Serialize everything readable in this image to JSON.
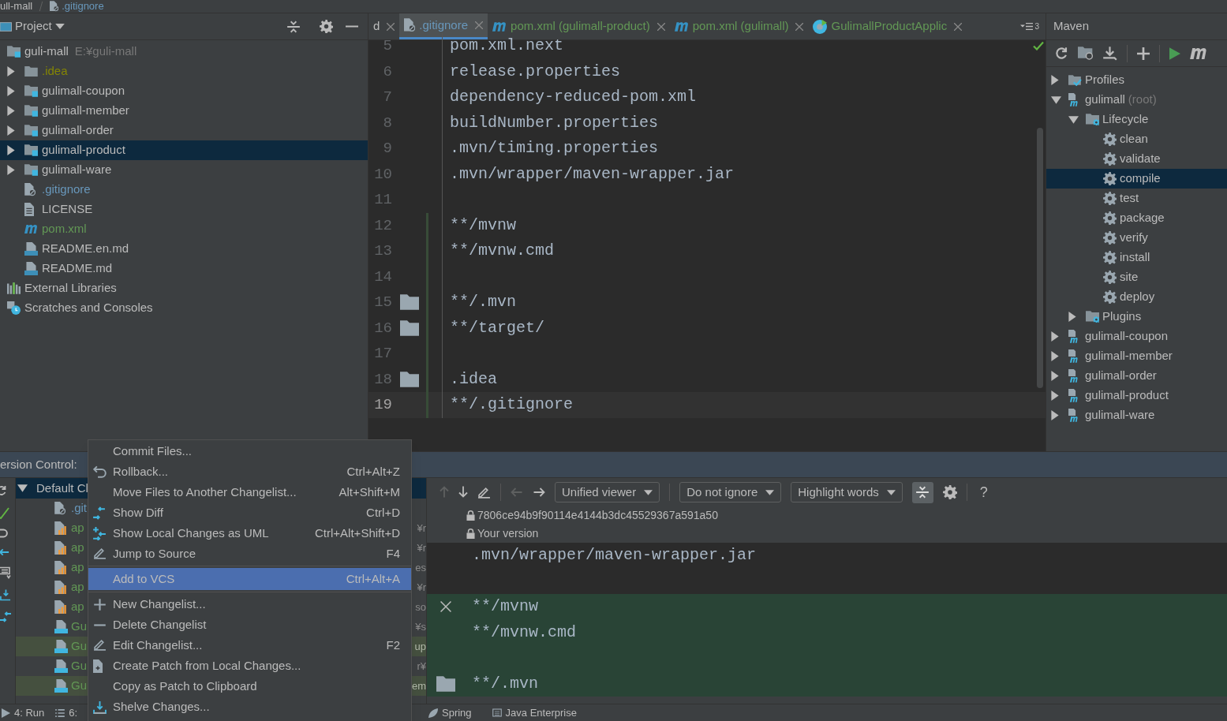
{
  "breadcrumb": [
    {
      "text": "ull-mall",
      "kind": "plain"
    },
    {
      "text": ".gitignore",
      "kind": "gitignore"
    }
  ],
  "project_panel": {
    "title": "Project",
    "tree": [
      {
        "label": "guli-mall",
        "detail": "E:¥guli-mall",
        "kind": "module",
        "selected": false,
        "children": [
          {
            "label": ".idea",
            "kind": "ignored_folder",
            "expanded": false,
            "selected": false
          },
          {
            "label": "gulimall-coupon",
            "kind": "module",
            "expanded": false,
            "selected": false
          },
          {
            "label": "gulimall-member",
            "kind": "module",
            "expanded": false,
            "selected": false
          },
          {
            "label": "gulimall-order",
            "kind": "module",
            "expanded": false,
            "selected": false
          },
          {
            "label": "gulimall-product",
            "kind": "module",
            "expanded": false,
            "selected": true
          },
          {
            "label": "gulimall-ware",
            "kind": "module",
            "expanded": false,
            "selected": false
          },
          {
            "label": ".gitignore",
            "kind": "gitignore",
            "selected": false
          },
          {
            "label": "LICENSE",
            "kind": "text",
            "selected": false
          },
          {
            "label": "pom.xml",
            "kind": "pom",
            "selected": false
          },
          {
            "label": "README.en.md",
            "kind": "md",
            "selected": false
          },
          {
            "label": "README.md",
            "kind": "md",
            "selected": false
          }
        ]
      },
      {
        "label": "External Libraries",
        "kind": "libraries",
        "selected": false
      },
      {
        "label": "Scratches and Consoles",
        "kind": "scratches",
        "selected": false
      }
    ]
  },
  "tabs": [
    {
      "label": "d",
      "kind": "plain",
      "selected": false
    },
    {
      "label": ".gitignore",
      "kind": "gitignore",
      "selected": true
    },
    {
      "label": "pom.xml (gulimall-product)",
      "kind": "pom",
      "selected": false
    },
    {
      "label": "pom.xml (gulimall)",
      "kind": "pom",
      "selected": false
    },
    {
      "label": "GulimallProductApplic",
      "kind": "app",
      "selected": false
    }
  ],
  "tab_overflow_count": "3",
  "editor_lines": [
    {
      "number": "5",
      "text": "pom.xml.next",
      "folder_icon": false,
      "changed": false,
      "current": false
    },
    {
      "number": "6",
      "text": "release.properties",
      "folder_icon": false,
      "changed": false,
      "current": false
    },
    {
      "number": "7",
      "text": "dependency-reduced-pom.xml",
      "folder_icon": false,
      "changed": false,
      "current": false
    },
    {
      "number": "8",
      "text": "buildNumber.properties",
      "folder_icon": false,
      "changed": false,
      "current": false
    },
    {
      "number": "9",
      "text": ".mvn/timing.properties",
      "folder_icon": false,
      "changed": false,
      "current": false
    },
    {
      "number": "10",
      "text": ".mvn/wrapper/maven-wrapper.jar",
      "folder_icon": false,
      "changed": false,
      "current": false
    },
    {
      "number": "11",
      "folder_icon": false,
      "changed": false,
      "current": false
    },
    {
      "number": "12",
      "text": "**/mvnw",
      "folder_icon": false,
      "changed": true,
      "current": false
    },
    {
      "number": "13",
      "text": "**/mvnw.cmd",
      "folder_icon": false,
      "changed": true,
      "current": false
    },
    {
      "number": "14",
      "folder_icon": false,
      "changed": true,
      "current": false
    },
    {
      "number": "15",
      "text": "**/.mvn",
      "folder_icon": true,
      "changed": true,
      "current": false
    },
    {
      "number": "16",
      "text": "**/target/",
      "folder_icon": true,
      "changed": true,
      "current": false
    },
    {
      "number": "17",
      "folder_icon": false,
      "changed": true,
      "current": false
    },
    {
      "number": "18",
      "text": ".idea",
      "folder_icon": true,
      "changed": true,
      "current": false
    },
    {
      "number": "19",
      "text": "**/.gitignore",
      "folder_icon": false,
      "changed": true,
      "current": true
    }
  ],
  "maven_panel": {
    "title": "Maven",
    "tree": [
      {
        "label": "Profiles",
        "kind": "profiles",
        "expanded": false,
        "selected": false
      },
      {
        "label": "gulimall",
        "detail": "(root)",
        "kind": "mvnmodule",
        "expanded": true,
        "selected": false,
        "children": [
          {
            "label": "Lifecycle",
            "kind": "lifecycle",
            "expanded": true,
            "selected": false,
            "children": [
              {
                "label": "clean",
                "kind": "goal",
                "selected": false
              },
              {
                "label": "validate",
                "kind": "goal",
                "selected": false
              },
              {
                "label": "compile",
                "kind": "goal",
                "selected": true
              },
              {
                "label": "test",
                "kind": "goal",
                "selected": false
              },
              {
                "label": "package",
                "kind": "goal",
                "selected": false
              },
              {
                "label": "verify",
                "kind": "goal",
                "selected": false
              },
              {
                "label": "install",
                "kind": "goal",
                "selected": false
              },
              {
                "label": "site",
                "kind": "goal",
                "selected": false
              },
              {
                "label": "deploy",
                "kind": "goal",
                "selected": false
              }
            ]
          },
          {
            "label": "Plugins",
            "kind": "lifecycle",
            "expanded": false,
            "selected": false
          }
        ]
      },
      {
        "label": "gulimall-coupon",
        "kind": "mvnmodule",
        "expanded": false,
        "selected": false
      },
      {
        "label": "gulimall-member",
        "kind": "mvnmodule",
        "expanded": false,
        "selected": false
      },
      {
        "label": "gulimall-order",
        "kind": "mvnmodule",
        "expanded": false,
        "selected": false
      },
      {
        "label": "gulimall-product",
        "kind": "mvnmodule",
        "expanded": false,
        "selected": false
      },
      {
        "label": "gulimall-ware",
        "kind": "mvnmodule",
        "expanded": false,
        "selected": false
      }
    ]
  },
  "version_control": {
    "title": "ersion Control:",
    "changelist": {
      "label": "Default Cl",
      "expanded": true,
      "selected": true,
      "children": [
        {
          "label": ".git",
          "kind": "gitignore",
          "selected": false
        },
        {
          "label": "ap",
          "kind": "chart",
          "path": "¥r",
          "selected": false
        },
        {
          "label": "ap",
          "kind": "chart",
          "path": "¥r",
          "selected": false
        },
        {
          "label": "ap",
          "kind": "chart",
          "path": "es",
          "selected": false
        },
        {
          "label": "ap",
          "kind": "chart",
          "path": "¥r",
          "selected": false
        },
        {
          "label": "ap",
          "kind": "chart",
          "path": "so",
          "selected": false
        },
        {
          "label": "Gu",
          "kind": "java",
          "path": "¥s",
          "selected": false
        },
        {
          "label": "Gu",
          "kind": "java",
          "path": "up",
          "selected": true
        },
        {
          "label": "Gu",
          "kind": "java",
          "path": "r¥",
          "selected": false
        },
        {
          "label": "Gu",
          "kind": "java",
          "path": "em",
          "selected": true
        }
      ]
    }
  },
  "context_menu": [
    {
      "label": "Commit Files...",
      "kind": "plain",
      "selected": false
    },
    {
      "label": "Rollback...",
      "shortcut": "Ctrl+Alt+Z",
      "kind": "undo",
      "selected": false
    },
    {
      "label": "Move Files to Another Changelist...",
      "shortcut": "Alt+Shift+M",
      "kind": "plain",
      "selected": false
    },
    {
      "label": "Show Diff",
      "shortcut": "Ctrl+D",
      "kind": "diff",
      "selected": false
    },
    {
      "label": "Show Local Changes as UML",
      "shortcut": "Ctrl+Alt+Shift+D",
      "kind": "uml",
      "selected": false
    },
    {
      "label": "Jump to Source",
      "shortcut": "F4",
      "kind": "pencil",
      "selected": false
    },
    {
      "label": "Add to VCS",
      "shortcut": "Ctrl+Alt+A",
      "kind": "plain",
      "selected": true,
      "separator_before": true
    },
    {
      "label": "New Changelist...",
      "kind": "plus",
      "selected": false,
      "separator_before": true
    },
    {
      "label": "Delete Changelist",
      "kind": "minus",
      "selected": false
    },
    {
      "label": "Edit Changelist...",
      "shortcut": "F2",
      "kind": "pencil",
      "selected": false
    },
    {
      "label": "Create Patch from Local Changes...",
      "kind": "patch",
      "selected": false
    },
    {
      "label": "Copy as Patch to Clipboard",
      "kind": "plain",
      "selected": false
    },
    {
      "label": "Shelve Changes...",
      "kind": "shelve",
      "selected": false
    }
  ],
  "diff": {
    "dropdowns": [
      "Unified viewer",
      "Do not ignore",
      "Highlight words"
    ],
    "help": "?",
    "left_title": "7806ce94b9f90114e4144b3dc45529367a591a50",
    "right_title": "Your version",
    "lines": [
      {
        "kind": "context",
        "text": ".mvn/wrapper/maven-wrapper.jar"
      },
      {
        "kind": "context_blank"
      },
      {
        "kind": "added_revert",
        "text": "**/mvnw"
      },
      {
        "kind": "added",
        "text": "**/mvnw.cmd"
      },
      {
        "kind": "added_blank"
      },
      {
        "kind": "added_folder",
        "text": "**/.mvn"
      }
    ]
  },
  "status_bar": {
    "left": [
      {
        "label": "4: Run",
        "kind": "run"
      },
      {
        "label": "6:",
        "kind": "list"
      }
    ],
    "right": [
      {
        "label": "Spring",
        "kind": "leaf"
      },
      {
        "label": "Java Enterprise",
        "kind": "ee"
      }
    ]
  }
}
